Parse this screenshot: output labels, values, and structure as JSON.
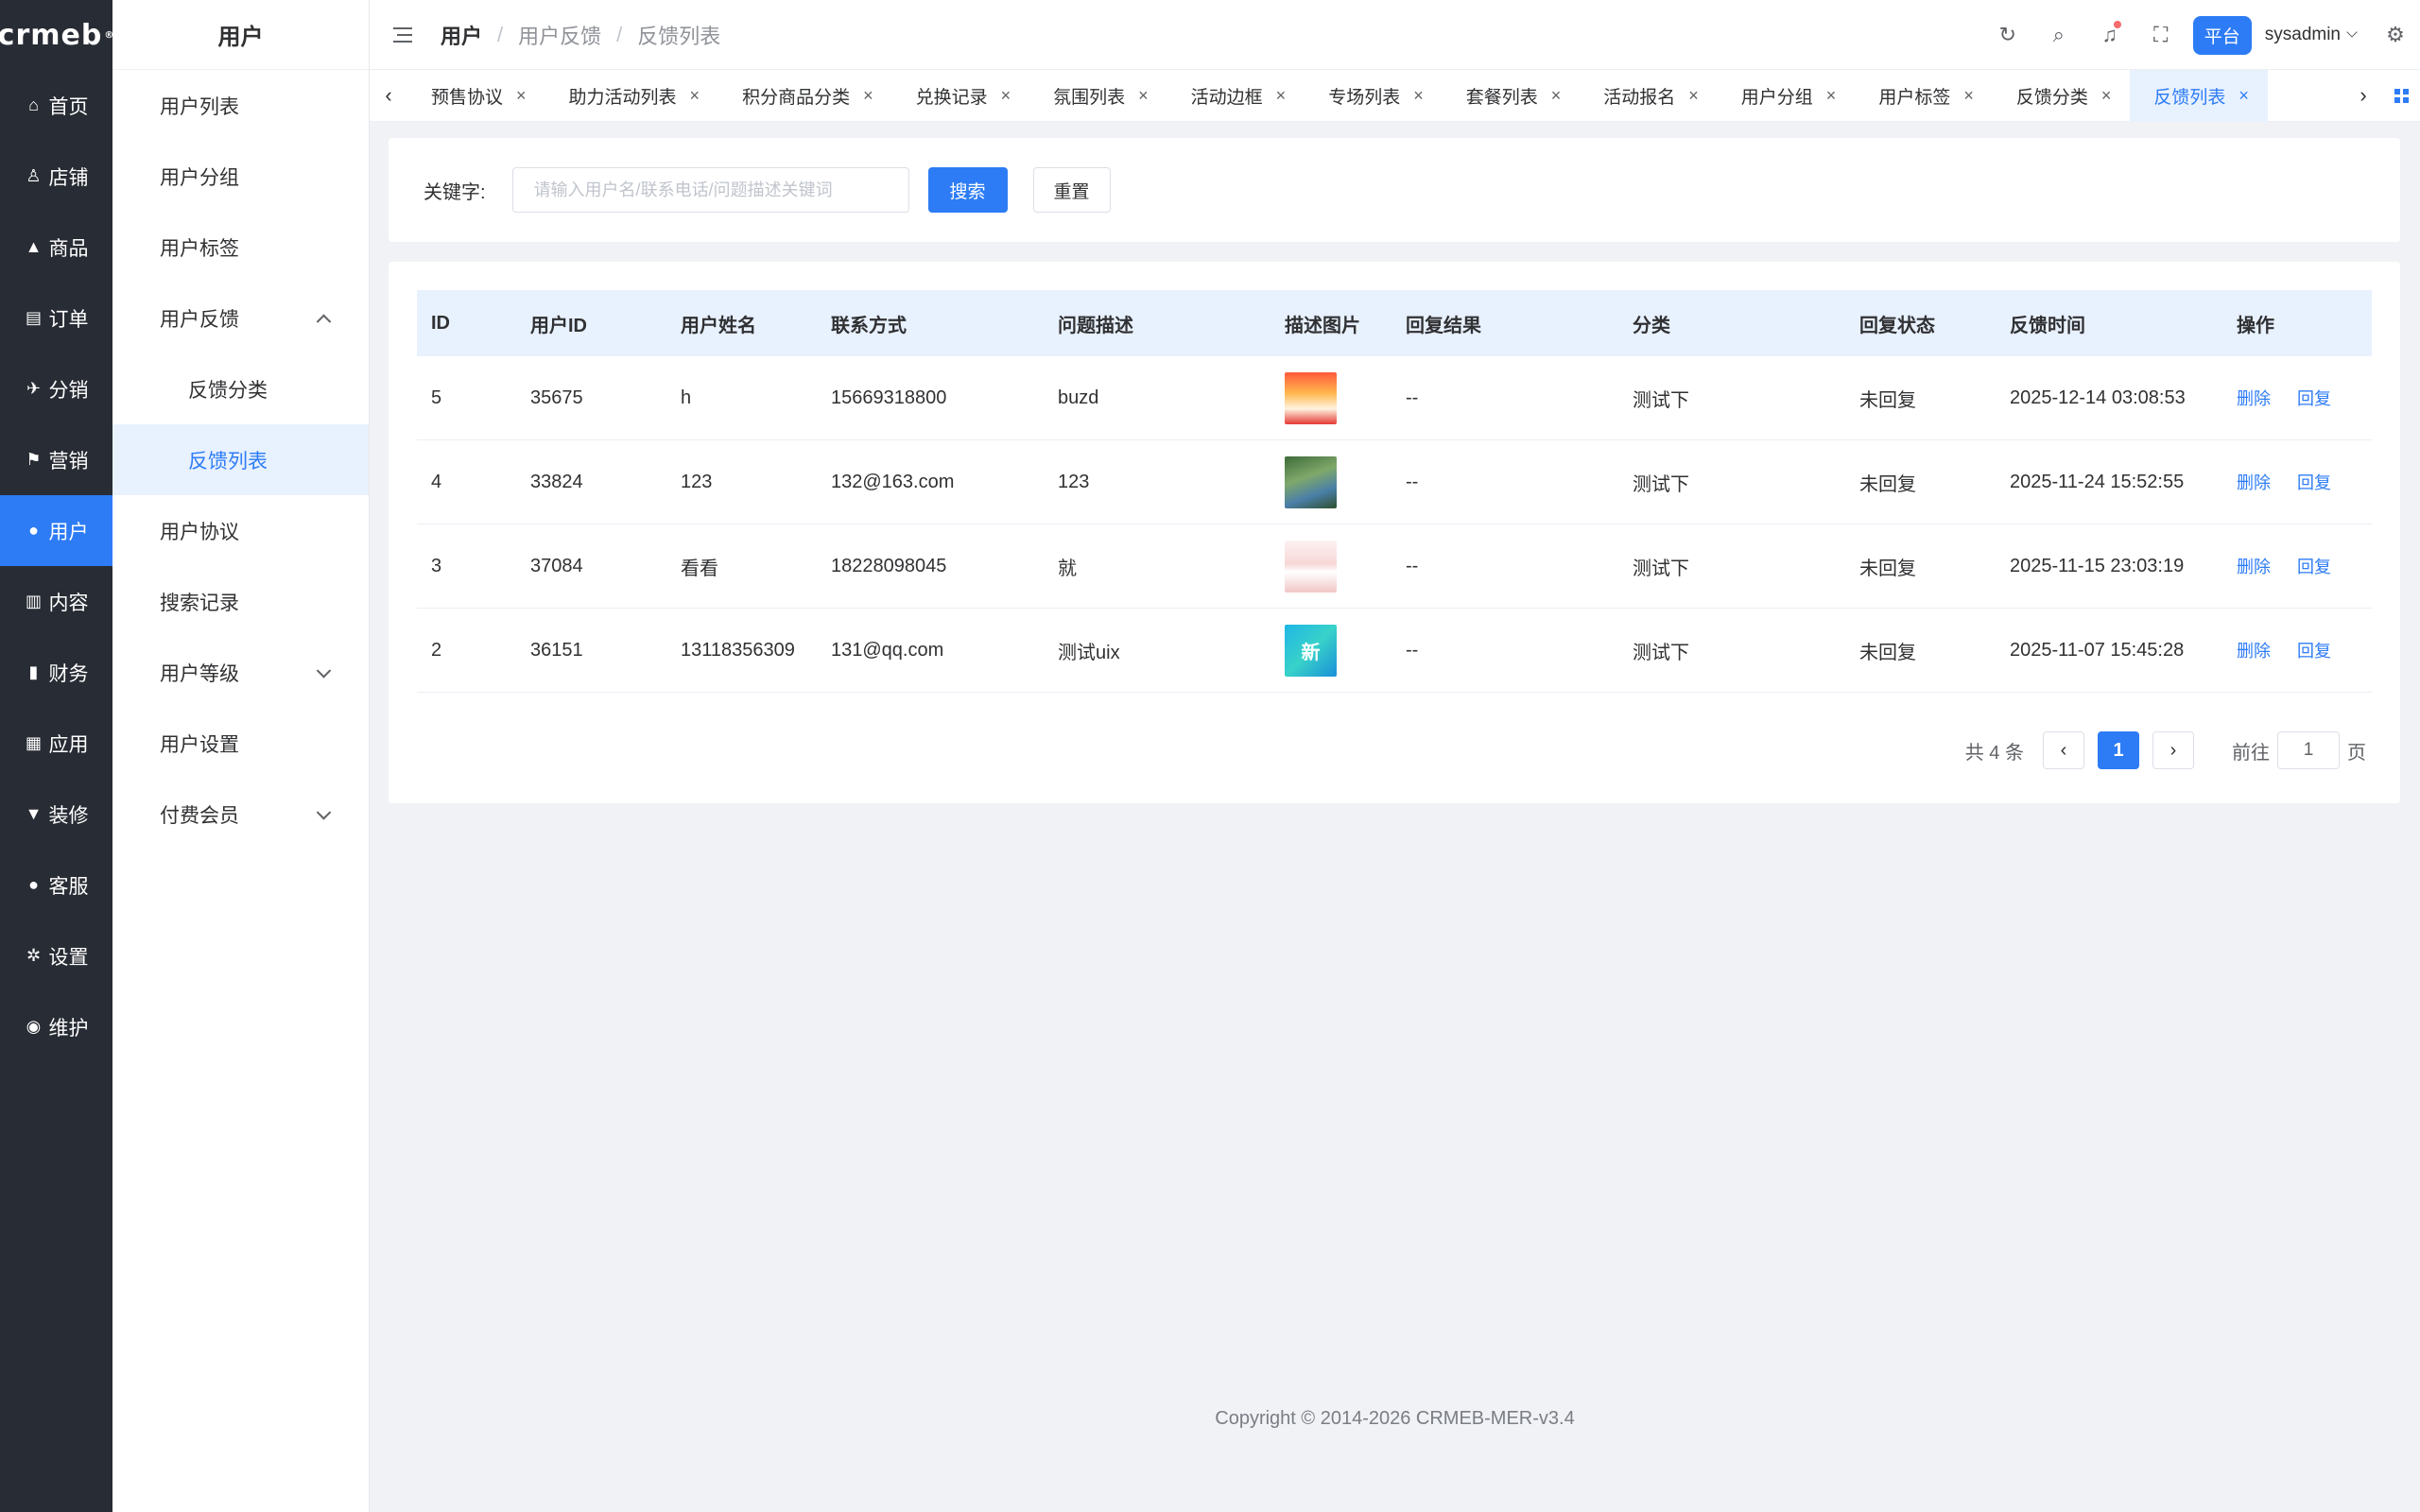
{
  "brand": {
    "logo": "crmeb",
    "logo_mark": "®"
  },
  "rail": [
    {
      "label": "首页",
      "icon": "⌂",
      "active": false
    },
    {
      "label": "店铺",
      "icon": "♙",
      "active": false
    },
    {
      "label": "商品",
      "icon": "▲",
      "active": false
    },
    {
      "label": "订单",
      "icon": "▤",
      "active": false
    },
    {
      "label": "分销",
      "icon": "✈",
      "active": false
    },
    {
      "label": "营销",
      "icon": "⚑",
      "active": false
    },
    {
      "label": "用户",
      "icon": "●",
      "active": true
    },
    {
      "label": "内容",
      "icon": "▥",
      "active": false
    },
    {
      "label": "财务",
      "icon": "▮",
      "active": false
    },
    {
      "label": "应用",
      "icon": "▦",
      "active": false
    },
    {
      "label": "装修",
      "icon": "▼",
      "active": false
    },
    {
      "label": "客服",
      "icon": "●",
      "active": false
    },
    {
      "label": "设置",
      "icon": "✲",
      "active": false
    },
    {
      "label": "维护",
      "icon": "◉",
      "active": false
    }
  ],
  "submenu": {
    "title": "用户",
    "items": [
      {
        "label": "用户列表"
      },
      {
        "label": "用户分组"
      },
      {
        "label": "用户标签"
      },
      {
        "label": "用户反馈"
      },
      {
        "label": "反馈分类"
      },
      {
        "label": "反馈列表"
      },
      {
        "label": "用户协议"
      },
      {
        "label": "搜索记录"
      },
      {
        "label": "用户等级"
      },
      {
        "label": "用户设置"
      },
      {
        "label": "付费会员"
      }
    ]
  },
  "breadcrumb": [
    "用户",
    "用户反馈",
    "反馈列表"
  ],
  "header": {
    "platform_label": "平台",
    "username": "sysadmin"
  },
  "tabs": [
    "预售协议",
    "助力活动列表",
    "积分商品分类",
    "兑换记录",
    "氛围列表",
    "活动边框",
    "专场列表",
    "套餐列表",
    "活动报名",
    "用户分组",
    "用户标签",
    "反馈分类",
    "反馈列表"
  ],
  "tab_close": "×",
  "search": {
    "label": "关键字:",
    "placeholder": "请输入用户名/联系电话/问题描述关键词",
    "search_label": "搜索",
    "reset_label": "重置"
  },
  "table": {
    "columns": [
      "ID",
      "用户ID",
      "用户姓名",
      "联系方式",
      "问题描述",
      "描述图片",
      "回复结果",
      "分类",
      "回复状态",
      "反馈时间",
      "操作"
    ],
    "rows": [
      {
        "id": "5",
        "uid": "35675",
        "name": "h",
        "contact": "15669318800",
        "desc": "buzd",
        "reply": "--",
        "category": "测试下",
        "status": "未回复",
        "time": "2025-12-14 03:08:53"
      },
      {
        "id": "4",
        "uid": "33824",
        "name": "123",
        "contact": "132@163.com",
        "desc": "123",
        "reply": "--",
        "category": "测试下",
        "status": "未回复",
        "time": "2025-11-24 15:52:55"
      },
      {
        "id": "3",
        "uid": "37084",
        "name": "看看",
        "contact": "18228098045",
        "desc": "就",
        "reply": "--",
        "category": "测试下",
        "status": "未回复",
        "time": "2025-11-15 23:03:19"
      },
      {
        "id": "2",
        "uid": "36151",
        "name": "13118356309",
        "contact": "131@qq.com",
        "desc": "测试uix",
        "reply": "--",
        "category": "测试下",
        "status": "未回复",
        "time": "2025-11-07 15:45:28"
      }
    ],
    "thumb_text_4": "新",
    "action_delete": "删除",
    "action_reply": "回复"
  },
  "pagination": {
    "total_label": "共 4 条",
    "current": "1",
    "goto_label": "前往",
    "goto_value": "1",
    "page_label": "页"
  },
  "footer": "Copyright © 2014-2026 CRMEB-MER-v3.4",
  "colors": {
    "primary": "#2d7cf6",
    "rail_bg": "#282c34",
    "active_bg": "#e8f1fe"
  }
}
